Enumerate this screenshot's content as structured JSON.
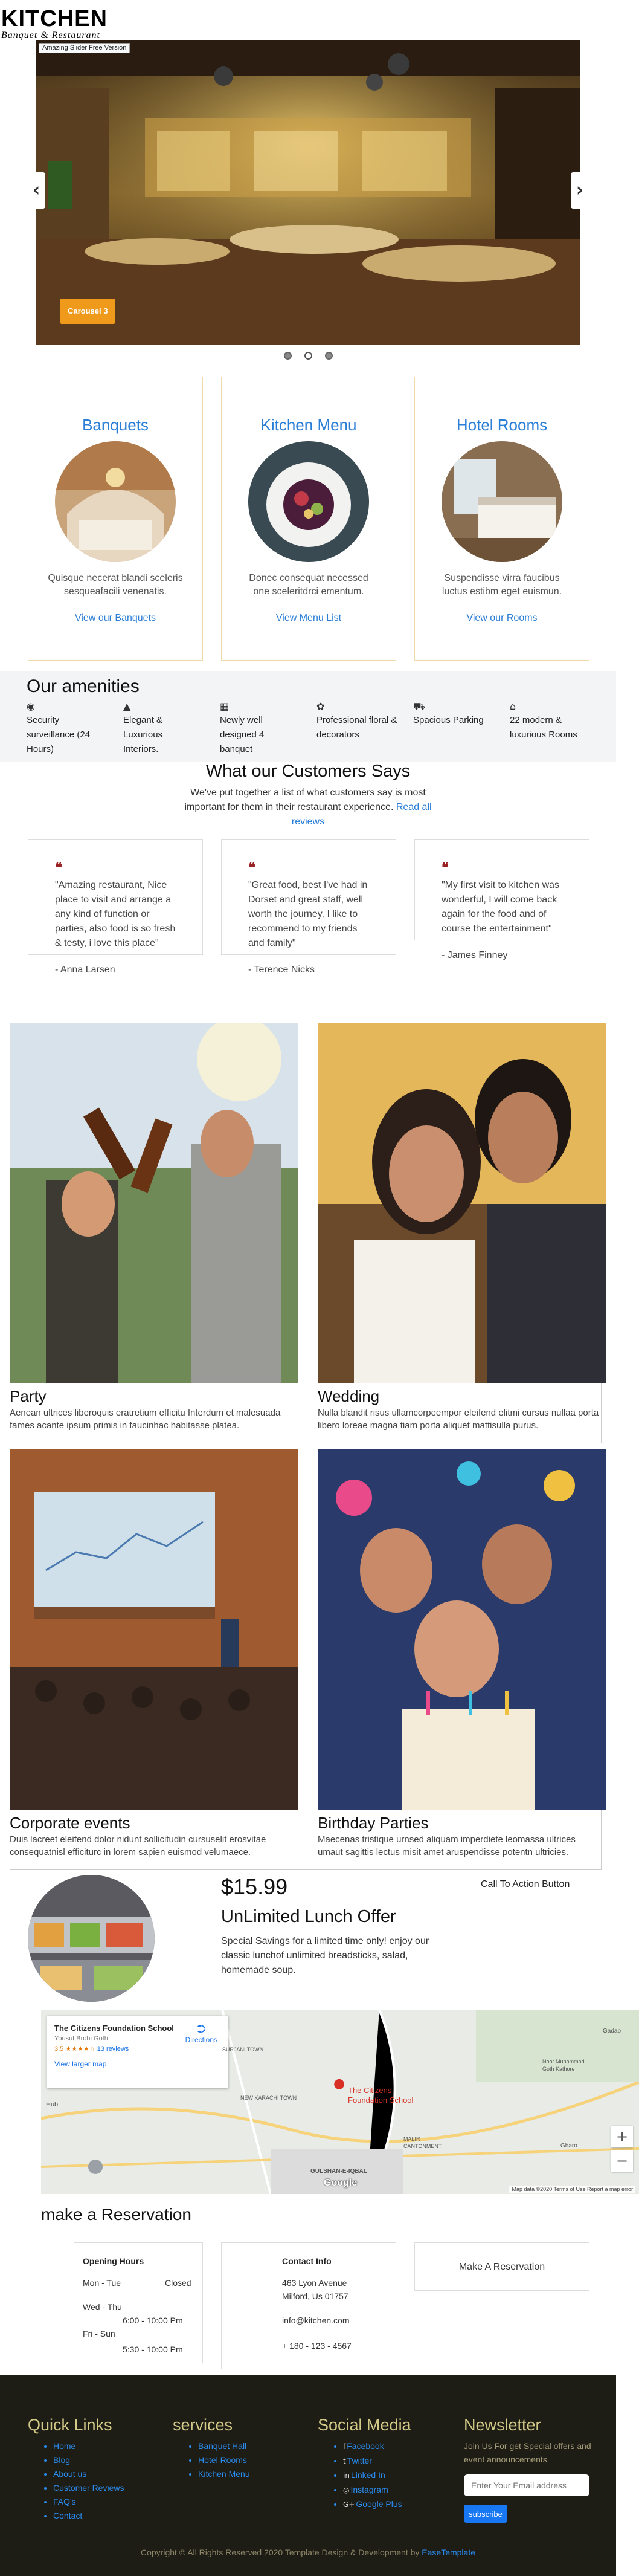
{
  "brand": {
    "title": "KITCHEN",
    "subtitle": "Banquet & Restaurant"
  },
  "slider": {
    "badge": "Amazing Slider Free Version",
    "caption": "Carousel 3",
    "prev_icon": "chevron-left-icon",
    "next_icon": "chevron-right-icon",
    "dots": 3,
    "active_dot": 2
  },
  "services": [
    {
      "title": "Banquets",
      "text": "Quisque necerat blandi sceleris sesqueafacili venenatis.",
      "link": "View our Banquets"
    },
    {
      "title": "Kitchen Menu",
      "text": "Donec consequat necessed one sceleritdrci ementum.",
      "link": "View Menu List"
    },
    {
      "title": "Hotel Rooms",
      "text": "Suspendisse virra faucibus luctus estibm eget euismun.",
      "link": "View our Rooms"
    }
  ],
  "amenities": {
    "title": "Our amenities",
    "items": [
      {
        "icon": "camera-icon",
        "label": "Security surveillance (24 Hours)"
      },
      {
        "icon": "landscape-icon",
        "label": "Elegant & Luxurious Interiors."
      },
      {
        "icon": "building-icon",
        "label": "Newly well designed 4 banquet"
      },
      {
        "icon": "flower-icon",
        "label": "Professional floral & decorators"
      },
      {
        "icon": "truck-icon",
        "label": "Spacious Parking"
      },
      {
        "icon": "bed-icon",
        "label": "22 modern & luxurious Rooms"
      }
    ]
  },
  "testimonials": {
    "title": "What our Customers Says",
    "subtitle": "We've put together a list of what customers say is most important for them in their restaurant experience.",
    "read_link": "Read all reviews",
    "items": [
      {
        "quote": "\"Amazing restaurant, Nice place to visit and arrange a any kind of function or parties, also food is so fresh & testy, i love this place\"",
        "author": "- Anna Larsen"
      },
      {
        "quote": "\"Great food, best I've had in Dorset and great staff, well worth the journey, I like to recommend to my friends and family\"",
        "author": "- Terence Nicks"
      },
      {
        "quote": "\"My first visit to kitchen was wonderful, I will come back again for the food and of course the entertainment\"",
        "author": "- James Finney"
      }
    ]
  },
  "events": [
    {
      "title": "Party",
      "text": "Aenean ultrices liberoquis eratretium efficitu Interdum et malesuada fames acante ipsum primis in faucinhac habitasse platea."
    },
    {
      "title": "Wedding",
      "text": "Nulla blandit risus ullamcorpeempor eleifend elitmi cursus nullaa porta libero loreae magna tiam porta aliquet mattisulla purus."
    },
    {
      "title": "Corporate events",
      "text": "Duis lacreet eleifend dolor nidunt sollicitudin cursuselit erosvitae consequatnisl efficiturc in lorem sapien euismod velumaece."
    },
    {
      "title": "Birthday Parties",
      "text": "Maecenas tristique urnsed aliquam imperdiete leomassa ultrices umaut sagittis lectus misit amet aruspendisse potentn ultricies."
    }
  ],
  "offer": {
    "price": "$15.99",
    "title": "UnLimited Lunch Offer",
    "text": "Special Savings for a limited time only! enjoy our classic lunchof unlimited breadsticks, salad, homemade soup.",
    "cta": "Call To Action Button"
  },
  "map": {
    "place": "The Citizens Foundation School",
    "address": "Yousuf Brohi Goth",
    "rating": "3.5",
    "stars": "★★★★☆",
    "reviews": "13 reviews",
    "directions": "Directions",
    "larger_map": "View larger map",
    "pin_label": "The Citizens Foundation School",
    "zoom_in": "+",
    "zoom_out": "−",
    "google": "Google",
    "footer": "Map data ©2020   Terms of Use   Report a map error",
    "labels": [
      "Hub",
      "NEW KARACHI TOWN",
      "SURJANI TOWN",
      "Noor Muhammad Goth Kathore",
      "MALIR CANTONMENT",
      "Gadap",
      "Gharo",
      "GULSHAN-E-IQBAL"
    ]
  },
  "reservation": {
    "title": "make a Reservation",
    "hours_title": "Opening Hours",
    "hours": [
      {
        "day": "Mon - Tue",
        "time": "Closed"
      },
      {
        "day": "Wed - Thu",
        "time": "6:00 - 10:00 Pm"
      },
      {
        "day": "Fri - Sun",
        "time": "5:30 - 10:00 Pm"
      }
    ],
    "contact_title": "Contact Info",
    "contact_lines": [
      "463 Lyon Avenue",
      "Milford, Us 01757",
      "info@kitchen.com",
      "+ 180 - 123 - 4567"
    ],
    "button": "Make A Reservation"
  },
  "footer": {
    "quick_links_title": "Quick Links",
    "quick_links": [
      "Home",
      "Blog",
      "About us",
      "Customer Reviews",
      "FAQ's",
      "Contact"
    ],
    "services_title": "services",
    "services": [
      "Banquet Hall",
      "Hotel Rooms",
      "Kitchen Menu"
    ],
    "social_title": "Social Media",
    "social": [
      {
        "icon": "facebook-icon",
        "glyph": "f",
        "label": "Facebook"
      },
      {
        "icon": "twitter-icon",
        "glyph": "t",
        "label": "Twitter"
      },
      {
        "icon": "linkedin-icon",
        "glyph": "in",
        "label": "Linked In"
      },
      {
        "icon": "instagram-icon",
        "glyph": "◎",
        "label": "Instagram"
      },
      {
        "icon": "google-plus-icon",
        "glyph": "G+",
        "label": "Google Plus"
      }
    ],
    "newsletter_title": "Newsletter",
    "newsletter_text": "Join Us For get Special offers and event announcements",
    "email_placeholder": "Enter Your Email address",
    "subscribe": "subscribe",
    "copyright": "Copyright © All Rights Reserved 2020 Template Design & Development by",
    "copyright_link": "EaseTemplate"
  },
  "colors": {
    "accent": "#2b7ed6",
    "caption": "#ef9a1a",
    "footer_bg": "#1d1c15",
    "footer_head": "#d4ca88"
  }
}
